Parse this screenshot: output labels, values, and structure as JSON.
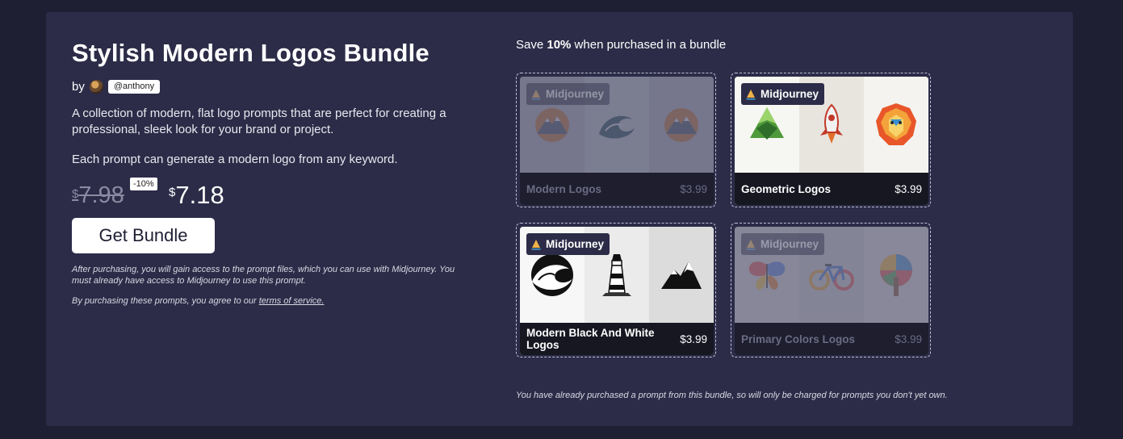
{
  "bundle": {
    "title": "Stylish Modern Logos Bundle",
    "by_label": "by",
    "author_handle": "@anthony",
    "description": "A collection of modern, flat logo prompts that are perfect for creating a professional, sleek look for your brand or project.",
    "description2": "Each prompt can generate a modern logo from any keyword.",
    "currency": "$",
    "old_price": "7.98",
    "discount_badge": "-10%",
    "new_price": "7.18",
    "button_label": "Get Bundle",
    "fine_print": "After purchasing, you will gain access to the prompt files, which you can use with Midjourney. You must already have access to Midjourney to use this prompt.",
    "terms_prefix": "By purchasing these prompts, you agree to our ",
    "terms_link": "terms of service."
  },
  "savings": {
    "prefix": "Save ",
    "percent": "10%",
    "suffix": " when purchased in a bundle"
  },
  "cards": [
    {
      "tag": "Midjourney",
      "name": "Modern Logos",
      "price": "$3.99",
      "owned": true,
      "thumbs": [
        "mountain-circle-icon",
        "wave-circle-icon",
        "mountain-circle-icon"
      ]
    },
    {
      "tag": "Midjourney",
      "name": "Geometric Logos",
      "price": "$3.99",
      "owned": false,
      "thumbs": [
        "green-mountain-icon",
        "rocket-icon",
        "lion-icon"
      ]
    },
    {
      "tag": "Midjourney",
      "name": "Modern Black And White Logos",
      "price": "$3.99",
      "owned": false,
      "thumbs": [
        "bw-wave-icon",
        "lighthouse-icon",
        "bw-mountain-icon"
      ]
    },
    {
      "tag": "Midjourney",
      "name": "Primary Colors Logos",
      "price": "$3.99",
      "owned": true,
      "thumbs": [
        "butterfly-icon",
        "bicycle-icon",
        "tree-icon"
      ]
    }
  ],
  "footer_note": "You have already purchased a prompt from this bundle, so will only be charged for prompts you don't yet own.",
  "colors": {
    "panel": "#2c2c48",
    "background": "#1f1f33",
    "caption": "#171722",
    "button": "#ffffff"
  }
}
